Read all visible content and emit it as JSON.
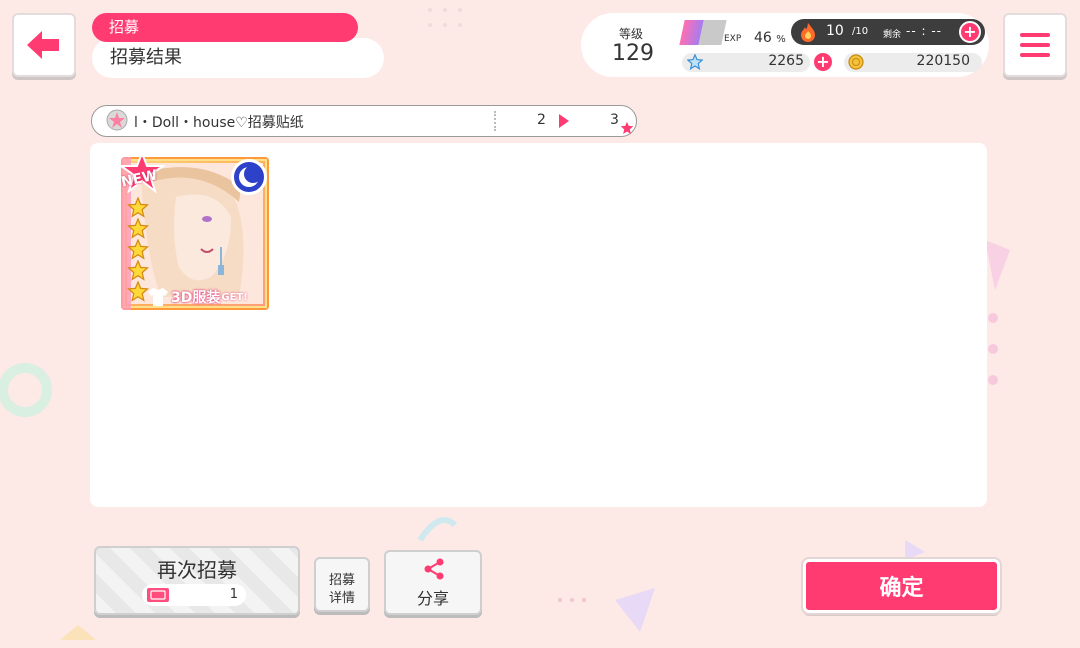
{
  "header": {
    "category": "招募",
    "title": "招募结果"
  },
  "status": {
    "level_label": "等级",
    "level": "129",
    "exp_label": "EXP",
    "exp_percent": "46",
    "exp_unit": "%",
    "exp_fraction": 0.46,
    "stamina": "10",
    "stamina_max": "/10",
    "remaining_label": "剩余",
    "remaining_time": "-- : --",
    "star_gems": "2265",
    "coins": "220150"
  },
  "source": {
    "name": "l・Doll・house♡招募贴纸",
    "count_from": "2",
    "count_to": "3"
  },
  "card": {
    "new_badge": "NEW",
    "stars": 5,
    "attribute": "moon",
    "costume_text": "3D服装",
    "costume_get": "GET!"
  },
  "buttons": {
    "again_label": "再次招募",
    "again_ticket_count": "1",
    "details_line1": "招募",
    "details_line2": "详情",
    "share_label": "分享",
    "confirm_label": "确定"
  },
  "colors": {
    "accent": "#ff3b72",
    "background": "#fde9e6"
  }
}
